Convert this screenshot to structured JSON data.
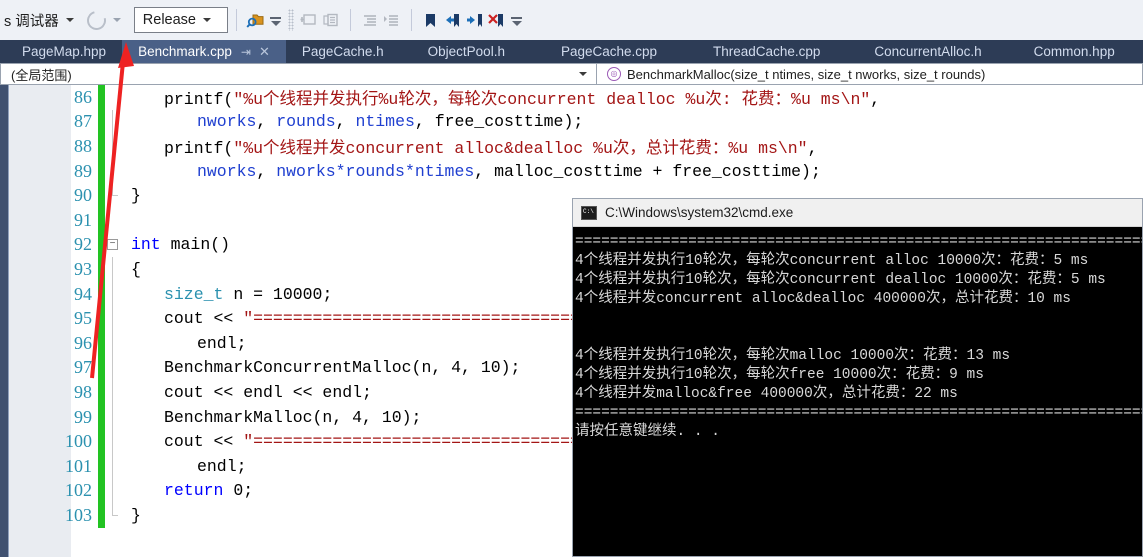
{
  "toolbar": {
    "debugger_label": "s 调试器",
    "config_label": "Release",
    "icons": [
      "find-in-files-icon",
      "drag-handle-icon",
      "comment-icon",
      "uncomment-icon",
      "indent-icon",
      "outdent-icon",
      "bookmark-icon",
      "prev-bookmark-icon",
      "next-bookmark-icon",
      "clear-bookmarks-icon"
    ]
  },
  "tabs": [
    {
      "label": "PageMap.hpp",
      "active": false,
      "closable": false
    },
    {
      "label": "Benchmark.cpp",
      "active": true,
      "closable": true,
      "pin": "⇥",
      "close": "✕"
    },
    {
      "label": "PageCache.h",
      "active": false,
      "closable": false
    },
    {
      "label": "ObjectPool.h",
      "active": false,
      "closable": false
    },
    {
      "label": "PageCache.cpp",
      "active": false,
      "closable": false
    },
    {
      "label": "ThreadCache.cpp",
      "active": false,
      "closable": false
    },
    {
      "label": "ConcurrentAlloc.h",
      "active": false,
      "closable": false
    },
    {
      "label": "Common.hpp",
      "active": false,
      "closable": false
    }
  ],
  "navbar": {
    "scope": "(全局范围)",
    "member": "BenchmarkMalloc(size_t ntimes, size_t nworks, size_t rounds)",
    "member_icon": "method-icon"
  },
  "editor": {
    "lines": [
      {
        "num": "86",
        "indent": 2,
        "segments": [
          {
            "t": "printf(",
            "c": "plain"
          },
          {
            "t": "\"%u个线程并发执行%u轮次，每轮次concurrent dealloc %u次: 花费：%u ms\\n\"",
            "c": "str"
          },
          {
            "t": ",",
            "c": "plain"
          }
        ]
      },
      {
        "num": "87",
        "indent": 3,
        "segments": [
          {
            "t": "nworks",
            "c": "var"
          },
          {
            "t": ", ",
            "c": "plain"
          },
          {
            "t": "rounds",
            "c": "var"
          },
          {
            "t": ", ",
            "c": "plain"
          },
          {
            "t": "ntimes",
            "c": "var"
          },
          {
            "t": ", ",
            "c": "plain"
          },
          {
            "t": "free_costtime",
            "c": "plain"
          },
          {
            "t": ");",
            "c": "plain"
          }
        ]
      },
      {
        "num": "88",
        "indent": 2,
        "segments": [
          {
            "t": "printf(",
            "c": "plain"
          },
          {
            "t": "\"%u个线程并发concurrent alloc&dealloc %u次，总计花费：%u ms\\n\"",
            "c": "str"
          },
          {
            "t": ",",
            "c": "plain"
          }
        ]
      },
      {
        "num": "89",
        "indent": 3,
        "segments": [
          {
            "t": "nworks",
            "c": "var"
          },
          {
            "t": ", ",
            "c": "plain"
          },
          {
            "t": "nworks*rounds*ntimes",
            "c": "var"
          },
          {
            "t": ", ",
            "c": "plain"
          },
          {
            "t": "malloc_costtime + free_costtime",
            "c": "plain"
          },
          {
            "t": ");",
            "c": "plain"
          }
        ]
      },
      {
        "num": "90",
        "indent": 1,
        "segments": [
          {
            "t": "}",
            "c": "plain"
          }
        ]
      },
      {
        "num": "91",
        "indent": 1,
        "segments": [
          {
            "t": "",
            "c": "plain"
          }
        ]
      },
      {
        "num": "92",
        "indent": 1,
        "collapse": "−",
        "segments": [
          {
            "t": "int",
            "c": "kw"
          },
          {
            "t": " main()",
            "c": "plain"
          }
        ]
      },
      {
        "num": "93",
        "indent": 1,
        "segments": [
          {
            "t": "{",
            "c": "plain"
          }
        ]
      },
      {
        "num": "94",
        "indent": 2,
        "segments": [
          {
            "t": "size_t",
            "c": "typ"
          },
          {
            "t": " n = 10000;",
            "c": "plain"
          }
        ]
      },
      {
        "num": "95",
        "indent": 2,
        "segments": [
          {
            "t": "cout << ",
            "c": "plain"
          },
          {
            "t": "\"==================================================================\"",
            "c": "str"
          },
          {
            "t": " <<",
            "c": "plain"
          }
        ]
      },
      {
        "num": "96",
        "indent": 3,
        "segments": [
          {
            "t": "endl;",
            "c": "plain"
          }
        ]
      },
      {
        "num": "97",
        "indent": 2,
        "segments": [
          {
            "t": "BenchmarkConcurrentMalloc(n, 4, 10);",
            "c": "plain"
          }
        ]
      },
      {
        "num": "98",
        "indent": 2,
        "segments": [
          {
            "t": "cout << endl << endl;",
            "c": "plain"
          }
        ]
      },
      {
        "num": "99",
        "indent": 2,
        "segments": [
          {
            "t": "BenchmarkMalloc(n, 4, 10);",
            "c": "plain"
          }
        ]
      },
      {
        "num": "100",
        "indent": 2,
        "segments": [
          {
            "t": "cout << ",
            "c": "plain"
          },
          {
            "t": "\"==================================================================\"",
            "c": "str"
          },
          {
            "t": " <<",
            "c": "plain"
          }
        ]
      },
      {
        "num": "101",
        "indent": 3,
        "segments": [
          {
            "t": "endl;",
            "c": "plain"
          }
        ]
      },
      {
        "num": "102",
        "indent": 2,
        "segments": [
          {
            "t": "return",
            "c": "kw"
          },
          {
            "t": " 0;",
            "c": "plain"
          }
        ]
      },
      {
        "num": "103",
        "indent": 1,
        "segments": [
          {
            "t": "}",
            "c": "plain"
          }
        ]
      }
    ]
  },
  "console": {
    "title": "C:\\Windows\\system32\\cmd.exe",
    "title_icon": "cmd-icon",
    "lines": [
      "==================================================================",
      "4个线程并发执行10轮次，每轮次concurrent alloc 10000次：花费：5 ms",
      "4个线程并发执行10轮次，每轮次concurrent dealloc 10000次：花费：5 ms",
      "4个线程并发concurrent alloc&dealloc 400000次，总计花费：10 ms",
      "",
      "",
      "4个线程并发执行10轮次，每轮次malloc 10000次：花费：13 ms",
      "4个线程并发执行10轮次，每轮次free 10000次：花费：9 ms",
      "4个线程并发malloc&free 400000次，总计花费：22 ms",
      "==================================================================",
      "请按任意键继续. . ."
    ]
  },
  "annotation": {
    "arrow_color": "#ee2222",
    "arrow_name": "red-pointer-arrow"
  },
  "colors": {
    "tabbar_bg": "#2d3c56",
    "tab_active_bg": "#4a6087",
    "changebar_green": "#22c322",
    "linenum": "#2b91af",
    "string": "#a31515",
    "keyword": "#0000ff"
  }
}
